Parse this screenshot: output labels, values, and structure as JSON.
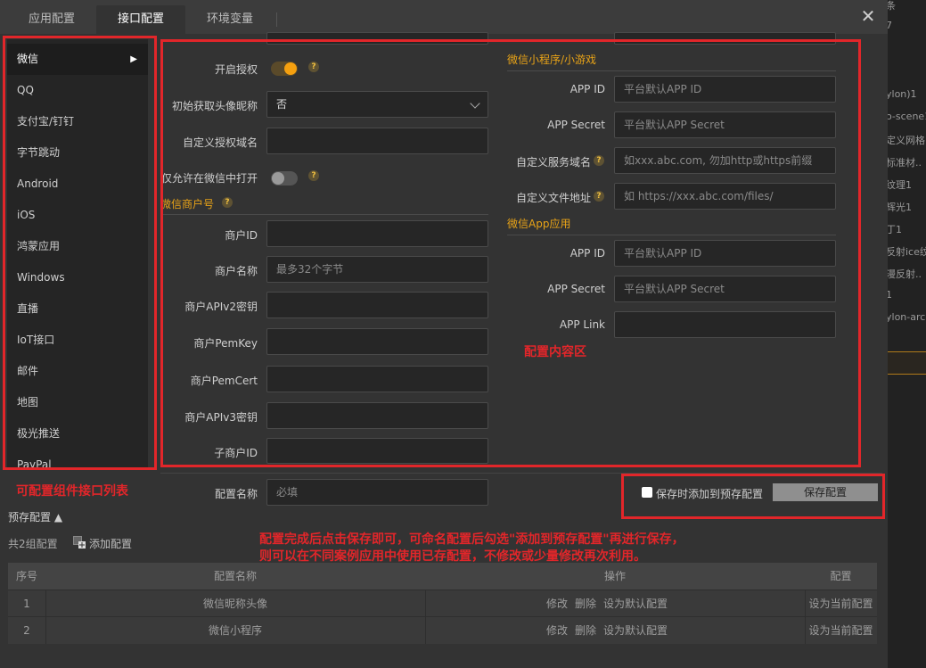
{
  "tabs": [
    {
      "label": "应用配置"
    },
    {
      "label": "接口配置"
    },
    {
      "label": "环境变量"
    }
  ],
  "close_label": "✕",
  "sidebar": {
    "items": [
      {
        "label": "微信"
      },
      {
        "label": "QQ"
      },
      {
        "label": "支付宝/钉钉"
      },
      {
        "label": "字节跳动"
      },
      {
        "label": "Android"
      },
      {
        "label": "iOS"
      },
      {
        "label": "鸿蒙应用"
      },
      {
        "label": "Windows"
      },
      {
        "label": "直播"
      },
      {
        "label": "IoT接口"
      },
      {
        "label": "邮件"
      },
      {
        "label": "地图"
      },
      {
        "label": "极光推送"
      },
      {
        "label": "PayPal"
      }
    ],
    "active_arrow": "▶"
  },
  "left_form": {
    "enable_auth": {
      "label": "开启授权",
      "value": true
    },
    "init_avatar": {
      "label": "初始获取头像昵称",
      "value": "否"
    },
    "custom_domain": {
      "label": "自定义授权域名",
      "value": ""
    },
    "wechat_only": {
      "label": "仅允许在微信中打开",
      "value": false
    },
    "merchant_section": "微信商户号",
    "merchant_id": {
      "label": "商户ID",
      "placeholder": ""
    },
    "merchant_name": {
      "label": "商户名称",
      "placeholder": "最多32个字节"
    },
    "apiv2_key": {
      "label": "商户APIv2密钥",
      "placeholder": ""
    },
    "pem_key": {
      "label": "商户PemKey",
      "placeholder": ""
    },
    "pem_cert": {
      "label": "商户PemCert",
      "placeholder": ""
    },
    "apiv3_key": {
      "label": "商户APIv3密钥",
      "placeholder": ""
    },
    "sub_merchant_id": {
      "label": "子商户ID",
      "placeholder": ""
    }
  },
  "right_form": {
    "miniprogram_section": "微信小程序/小游戏",
    "mp_app_id": {
      "label": "APP ID",
      "placeholder": "平台默认APP ID"
    },
    "mp_app_secret": {
      "label": "APP Secret",
      "placeholder": "平台默认APP Secret"
    },
    "mp_service_domain": {
      "label": "自定义服务域名",
      "placeholder": "如xxx.abc.com, 勿加http或https前缀"
    },
    "mp_file_url": {
      "label": "自定义文件地址",
      "placeholder": "如 https://xxx.abc.com/files/"
    },
    "app_section": "微信App应用",
    "app_id": {
      "label": "APP ID",
      "placeholder": "平台默认APP ID"
    },
    "app_secret": {
      "label": "APP Secret",
      "placeholder": "平台默认APP Secret"
    },
    "app_link": {
      "label": "APP Link",
      "placeholder": ""
    }
  },
  "help_glyph": "?",
  "config_name": {
    "label": "配置名称",
    "placeholder": "必填"
  },
  "save_area": {
    "checkbox_label": "保存时添加到预存配置",
    "save_button": "保存配置"
  },
  "presets": {
    "header": "预存配置 ▲",
    "count": "共2组配置",
    "add_label": "添加配置",
    "columns": [
      "序号",
      "配置名称",
      "操作",
      "配置"
    ],
    "rows": [
      {
        "index": "1",
        "name": "微信昵称头像",
        "edit": "修改",
        "delete": "删除",
        "set_default": "设为默认配置",
        "apply": "设为当前配置"
      },
      {
        "index": "2",
        "name": "微信小程序",
        "edit": "修改",
        "delete": "删除",
        "set_default": "设为默认配置",
        "apply": "设为当前配置"
      }
    ]
  },
  "annotations": {
    "list_note": "可配置组件接口列表",
    "content_note": "配置内容区",
    "save_note_line1": "配置完成后点击保存即可，可命名配置后勾选\"添加到预存配置\"再进行保存，",
    "save_note_line2": "则可以在不同案例应用中使用已存配置，不修改或少量修改再次利用。",
    "color": "#e2262a"
  },
  "background_panel": {
    "items": [
      "条",
      "7",
      "ylon)1",
      "o-scene1",
      "定义网格1",
      "标准材..",
      "纹理1",
      "辉光1",
      "丁1",
      "反射ice纹..",
      "漫反射..",
      "1",
      "ylon-arc.."
    ]
  }
}
